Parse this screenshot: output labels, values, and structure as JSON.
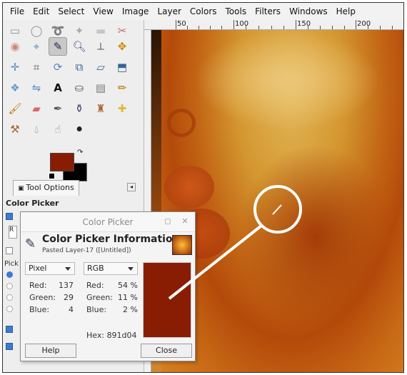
{
  "menubar": {
    "items": [
      "File",
      "Edit",
      "Select",
      "View",
      "Image",
      "Layer",
      "Colors",
      "Tools",
      "Filters",
      "Windows",
      "Help"
    ]
  },
  "ruler": {
    "labels": [
      "50",
      "100",
      "150",
      "200"
    ]
  },
  "toolbox": {
    "tab_label": "Tool Options",
    "section_title": "Color Picker",
    "foreground_color": "#891d04",
    "background_color": "#000000"
  },
  "dialog": {
    "title": "Color Picker",
    "heading": "Color Picker Information",
    "subheading": "Pasted Layer-17 ([Untitled])",
    "left_mode": "Pixel",
    "right_mode": "RGB",
    "pixel": {
      "red_label": "Red:",
      "red_value": "137",
      "green_label": "Green:",
      "green_value": "29",
      "blue_label": "Blue:",
      "blue_value": "4"
    },
    "rgb": {
      "red_label": "Red:",
      "red_value": "54 %",
      "green_label": "Green:",
      "green_value": "11 %",
      "blue_label": "Blue:",
      "blue_value": "2 %"
    },
    "hex_label": "Hex:",
    "hex_value": "891d04",
    "swatch_color": "#891d04",
    "help_label": "Help",
    "close_label": "Close"
  }
}
